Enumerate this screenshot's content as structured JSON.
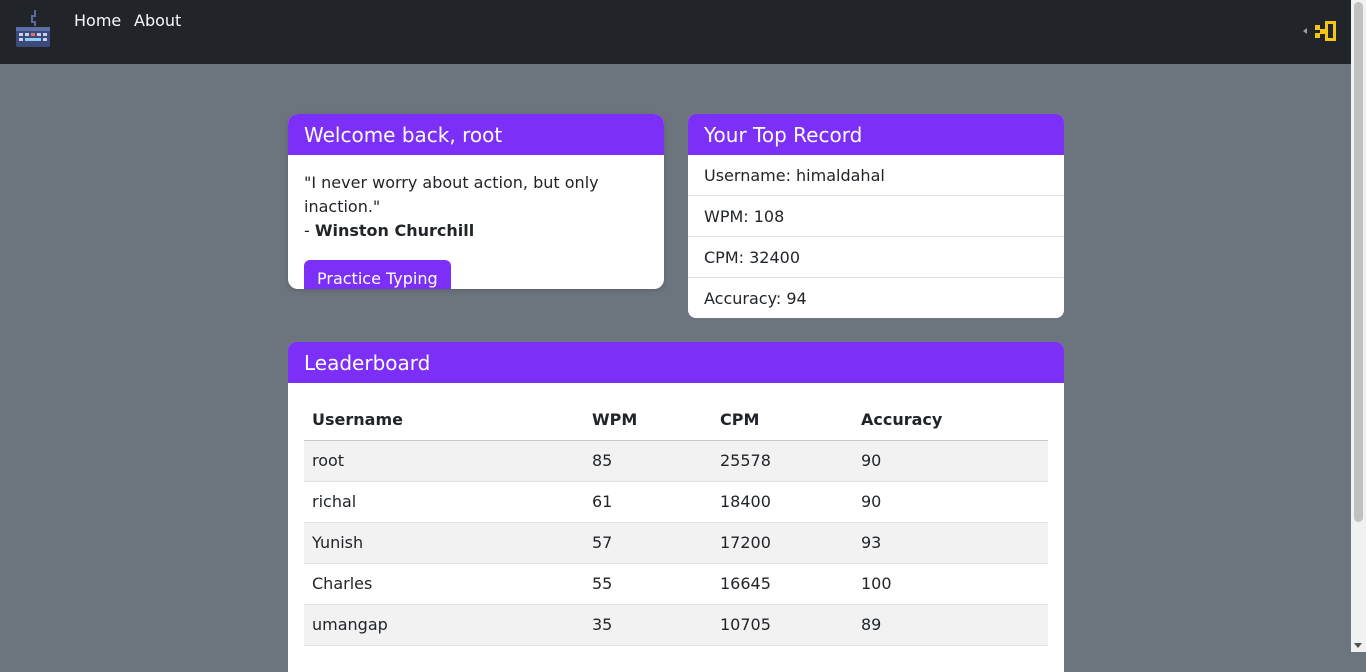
{
  "nav": {
    "home": "Home",
    "about": "About"
  },
  "welcome": {
    "title": "Welcome back, root",
    "quote": "\"I never worry about action, but only inaction.\"",
    "author_prefix": "- ",
    "author": "Winston Churchill",
    "button": "Practice Typing"
  },
  "record": {
    "title": "Your Top Record",
    "items": [
      "Username: himaldahal",
      "WPM: 108",
      "CPM: 32400",
      "Accuracy: 94"
    ]
  },
  "leaderboard": {
    "title": "Leaderboard",
    "columns": [
      "Username",
      "WPM",
      "CPM",
      "Accuracy"
    ],
    "rows": [
      [
        "root",
        "85",
        "25578",
        "90"
      ],
      [
        "richal",
        "61",
        "18400",
        "90"
      ],
      [
        "Yunish",
        "57",
        "17200",
        "93"
      ],
      [
        "Charles",
        "55",
        "16645",
        "100"
      ],
      [
        "umangap",
        "35",
        "10705",
        "89"
      ]
    ]
  },
  "colors": {
    "accent": "#7b2ff7",
    "navbar": "#212529",
    "background": "#6c757d"
  },
  "icons": {
    "logo": "keyboard-logo-icon",
    "logout": "logout-icon"
  }
}
